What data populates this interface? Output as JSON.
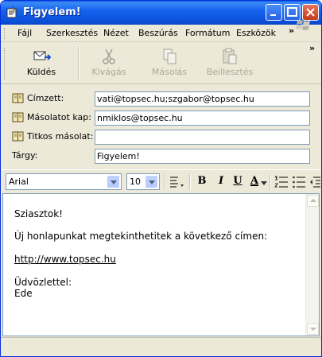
{
  "window": {
    "title": "Figyelem!"
  },
  "menu": {
    "items": [
      {
        "label": "Fájl"
      },
      {
        "label": "Szerkesztés"
      },
      {
        "label": "Nézet"
      },
      {
        "label": "Beszúrás"
      },
      {
        "label": "Formátum"
      },
      {
        "label": "Eszközök"
      }
    ],
    "overflow": "»"
  },
  "toolbar": {
    "send": {
      "label": "Küldés",
      "icon": "send-icon",
      "enabled": true
    },
    "cut": {
      "label": "Kivágás",
      "icon": "scissors-icon",
      "enabled": false
    },
    "copy": {
      "label": "Másolás",
      "icon": "copy-icon",
      "enabled": false
    },
    "paste": {
      "label": "Beillesztés",
      "icon": "paste-icon",
      "enabled": false
    },
    "overflow": "»"
  },
  "fields": {
    "to": {
      "label": "Címzett:",
      "value": "vati@topsec.hu;szgabor@topsec.hu"
    },
    "cc": {
      "label": "Másolatot kap:",
      "value": "nmiklos@topsec.hu"
    },
    "bcc": {
      "label": "Titkos másolat:",
      "value": ""
    },
    "subject": {
      "label": "Tárgy:",
      "value": "Figyelem!"
    }
  },
  "format": {
    "font": "Arial",
    "size": "10",
    "bold": "B",
    "italic": "I",
    "underline": "U",
    "font_color": "A"
  },
  "message": {
    "greeting": "Sziasztok!",
    "line1": "Új honlapunkat megtekinthetitek a következő címen:",
    "link": "http://www.topsec.hu",
    "closing": "Üdvözlettel:",
    "signature": "Ede"
  }
}
